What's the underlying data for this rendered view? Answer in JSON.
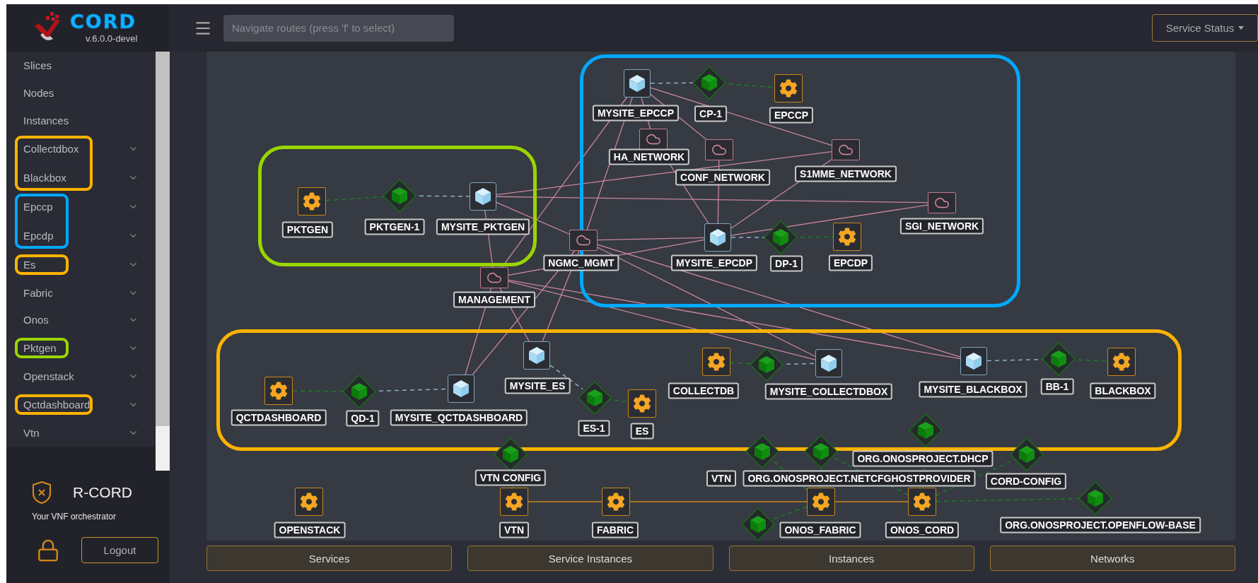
{
  "sidebar": {
    "logo": {
      "wordmark": "CORD",
      "version": "v.6.0.0-devel"
    },
    "items": [
      {
        "label": "Slices",
        "expandable": false
      },
      {
        "label": "Nodes",
        "expandable": false
      },
      {
        "label": "Instances",
        "expandable": false
      },
      {
        "label": "Collectdbox",
        "expandable": true,
        "color": "#ffb300"
      },
      {
        "label": "Blackbox",
        "expandable": true,
        "color": "#ffb300"
      },
      {
        "label": "Epccp",
        "expandable": true,
        "color": "#00a8ff"
      },
      {
        "label": "Epcdp",
        "expandable": true,
        "color": "#00a8ff"
      },
      {
        "label": "Es",
        "expandable": true,
        "color": "#ffb301"
      },
      {
        "label": "Fabric",
        "expandable": true
      },
      {
        "label": "Onos",
        "expandable": true
      },
      {
        "label": "Pktgen",
        "expandable": true,
        "color": "#9ad500"
      },
      {
        "label": "Openstack",
        "expandable": true
      },
      {
        "label": "Qctdashboard",
        "expandable": true,
        "color": "#ffb300"
      },
      {
        "label": "Vtn",
        "expandable": true
      }
    ],
    "footer": {
      "title": "R-CORD",
      "subtitle": "Your VNF orchestrator",
      "logout": "Logout"
    }
  },
  "topbar": {
    "search": {
      "placeholder": "Navigate routes (press 'f' to select)"
    },
    "status_button": "Service Status"
  },
  "graph": {
    "groups": [
      {
        "color": "#9ad500"
      },
      {
        "color": "#00a8ff"
      },
      {
        "color": "#ffb300"
      }
    ],
    "nodes": [
      {
        "kind": "slice",
        "label": "MYSITE_EPCCP"
      },
      {
        "kind": "instance",
        "label": "CP-1"
      },
      {
        "kind": "service",
        "label": "EPCCP"
      },
      {
        "kind": "network",
        "label": "HA_NETWORK"
      },
      {
        "kind": "network",
        "label": "CONF_NETWORK"
      },
      {
        "kind": "network",
        "label": "S1MME_NETWORK"
      },
      {
        "kind": "service",
        "label": "PKTGEN"
      },
      {
        "kind": "instance",
        "label": "PKTGEN-1"
      },
      {
        "kind": "slice",
        "label": "MYSITE_PKTGEN"
      },
      {
        "kind": "network",
        "label": "SGI_NETWORK"
      },
      {
        "kind": "network",
        "label": "NGMC_MGMT"
      },
      {
        "kind": "slice",
        "label": "MYSITE_EPCDP"
      },
      {
        "kind": "instance",
        "label": "DP-1"
      },
      {
        "kind": "service",
        "label": "EPCDP"
      },
      {
        "kind": "network",
        "label": "MANAGEMENT"
      },
      {
        "kind": "slice",
        "label": "MYSITE_ES"
      },
      {
        "kind": "service",
        "label": "COLLECTDB"
      },
      {
        "kind": "instance"
      },
      {
        "kind": "slice",
        "label": "MYSITE_COLLECTDBOX"
      },
      {
        "kind": "slice",
        "label": "MYSITE_BLACKBOX"
      },
      {
        "kind": "instance",
        "label": "BB-1"
      },
      {
        "kind": "service",
        "label": "BLACKBOX"
      },
      {
        "kind": "service",
        "label": "QCTDASHBOARD"
      },
      {
        "kind": "instance",
        "label": "QD-1"
      },
      {
        "kind": "slice",
        "label": "MYSITE_QCTDASHBOARD"
      },
      {
        "kind": "instance",
        "label": "ES-1"
      },
      {
        "kind": "service",
        "label": "ES"
      },
      {
        "kind": "instance",
        "label": "ORG.ONOSPROJECT.DHCP"
      },
      {
        "kind": "instance",
        "label": "VTN CONFIG"
      },
      {
        "kind": "instance",
        "label": "VTN"
      },
      {
        "kind": "instance",
        "label": "ORG.ONOSPROJECT.NETCFGHOSTPROVIDER"
      },
      {
        "kind": "instance",
        "label": "CORD-CONFIG"
      },
      {
        "kind": "service",
        "label": "OPENSTACK"
      },
      {
        "kind": "service",
        "label": "VTN"
      },
      {
        "kind": "service",
        "label": "FABRIC"
      },
      {
        "kind": "service",
        "label": "ONOS_FABRIC"
      },
      {
        "kind": "service",
        "label": "ONOS_CORD"
      },
      {
        "kind": "instance",
        "label": "ORG.ONOSPROJECT.OPENFLOW-BASE"
      },
      {
        "kind": "instance"
      }
    ]
  },
  "bottom_buttons": [
    "Services",
    "Service Instances",
    "Instances",
    "Networks"
  ]
}
